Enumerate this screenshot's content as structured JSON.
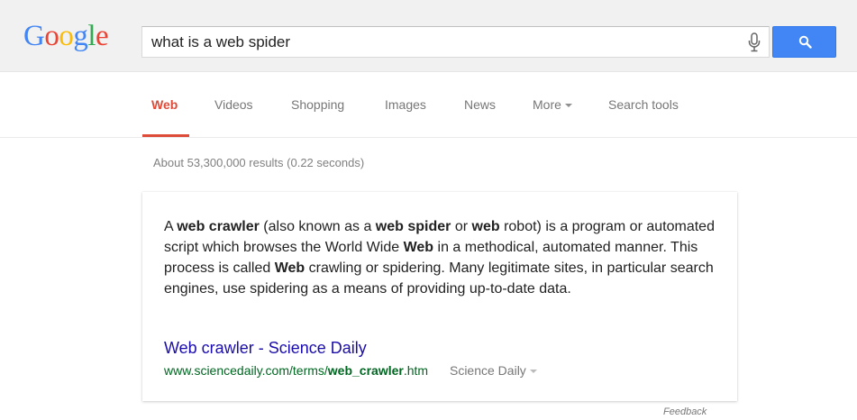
{
  "header": {
    "logo_letters": [
      {
        "ch": "G",
        "color": "#4285f4"
      },
      {
        "ch": "o",
        "color": "#ea4335"
      },
      {
        "ch": "o",
        "color": "#fbbc05"
      },
      {
        "ch": "g",
        "color": "#4285f4"
      },
      {
        "ch": "l",
        "color": "#34a853"
      },
      {
        "ch": "e",
        "color": "#ea4335"
      }
    ],
    "search_query": "what is a web spider",
    "mic_icon": "microphone-icon",
    "search_button_icon": "search-icon",
    "search_button_color": "#4285f4"
  },
  "tabs": {
    "items": [
      {
        "label": "Web",
        "active": true
      },
      {
        "label": "Videos",
        "active": false
      },
      {
        "label": "Shopping",
        "active": false
      },
      {
        "label": "Images",
        "active": false
      },
      {
        "label": "News",
        "active": false
      },
      {
        "label": "More",
        "active": false
      },
      {
        "label": "Search tools",
        "active": false
      }
    ],
    "active_color": "#dd4b39"
  },
  "stats": "About 53,300,000 results (0.22 seconds)",
  "answer_card": {
    "snippet_segments": [
      {
        "t": "A ",
        "b": false
      },
      {
        "t": "web crawler",
        "b": true
      },
      {
        "t": " (also known as a ",
        "b": false
      },
      {
        "t": "web spider",
        "b": true
      },
      {
        "t": " or ",
        "b": false
      },
      {
        "t": "web",
        "b": true
      },
      {
        "t": " robot) is a program or automated script which browses the World Wide ",
        "b": false
      },
      {
        "t": "Web",
        "b": true
      },
      {
        "t": " in a methodical, automated manner. This process is called ",
        "b": false
      },
      {
        "t": "Web",
        "b": true
      },
      {
        "t": " crawling or spidering. Many legitimate sites, in particular search engines, use spidering as a means of providing up-to-date data.",
        "b": false
      }
    ],
    "result_title": "Web crawler - Science Daily",
    "url_prefix": "www.sciencedaily.com/terms/",
    "url_bold": "web_crawler",
    "url_suffix": ".htm",
    "source_label": "Science Daily",
    "title_color": "#1a0dab",
    "url_color": "#006621"
  },
  "feedback_label": "Feedback"
}
